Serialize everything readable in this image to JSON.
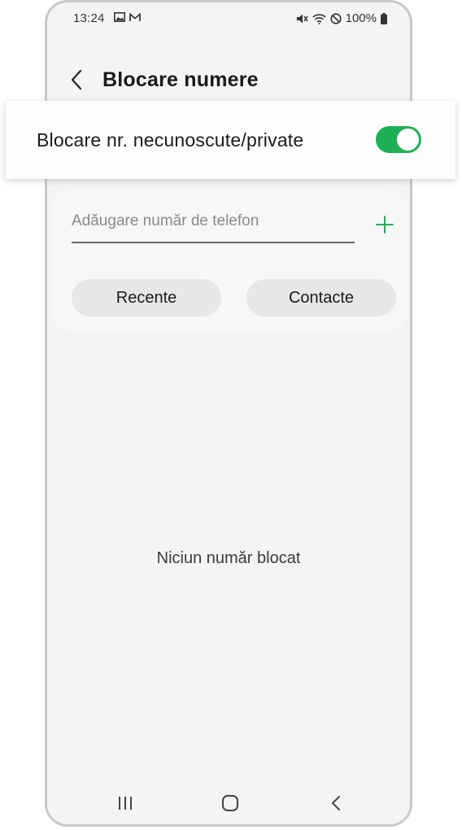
{
  "status_bar": {
    "time": "13:24",
    "left_icons": [
      "image-icon",
      "gmail-icon"
    ],
    "right_icons": [
      "mute-icon",
      "wifi-icon",
      "dnd-icon",
      "battery-icon"
    ],
    "battery": "100%"
  },
  "header": {
    "title": "Blocare numere",
    "back_icon": "chevron-left-icon"
  },
  "block_unknown": {
    "label": "Blocare nr. necunoscute/private",
    "toggle_on": true,
    "toggle_color": "#1db057"
  },
  "add_number": {
    "placeholder": "Adăugare număr de telefon",
    "value": "",
    "add_icon": "plus-icon",
    "accent": "#1db057"
  },
  "buttons": {
    "recent": "Recente",
    "contacts": "Contacte"
  },
  "empty_state": "Niciun număr blocat",
  "nav_bar": [
    "recents-icon",
    "home-icon",
    "back-icon"
  ]
}
